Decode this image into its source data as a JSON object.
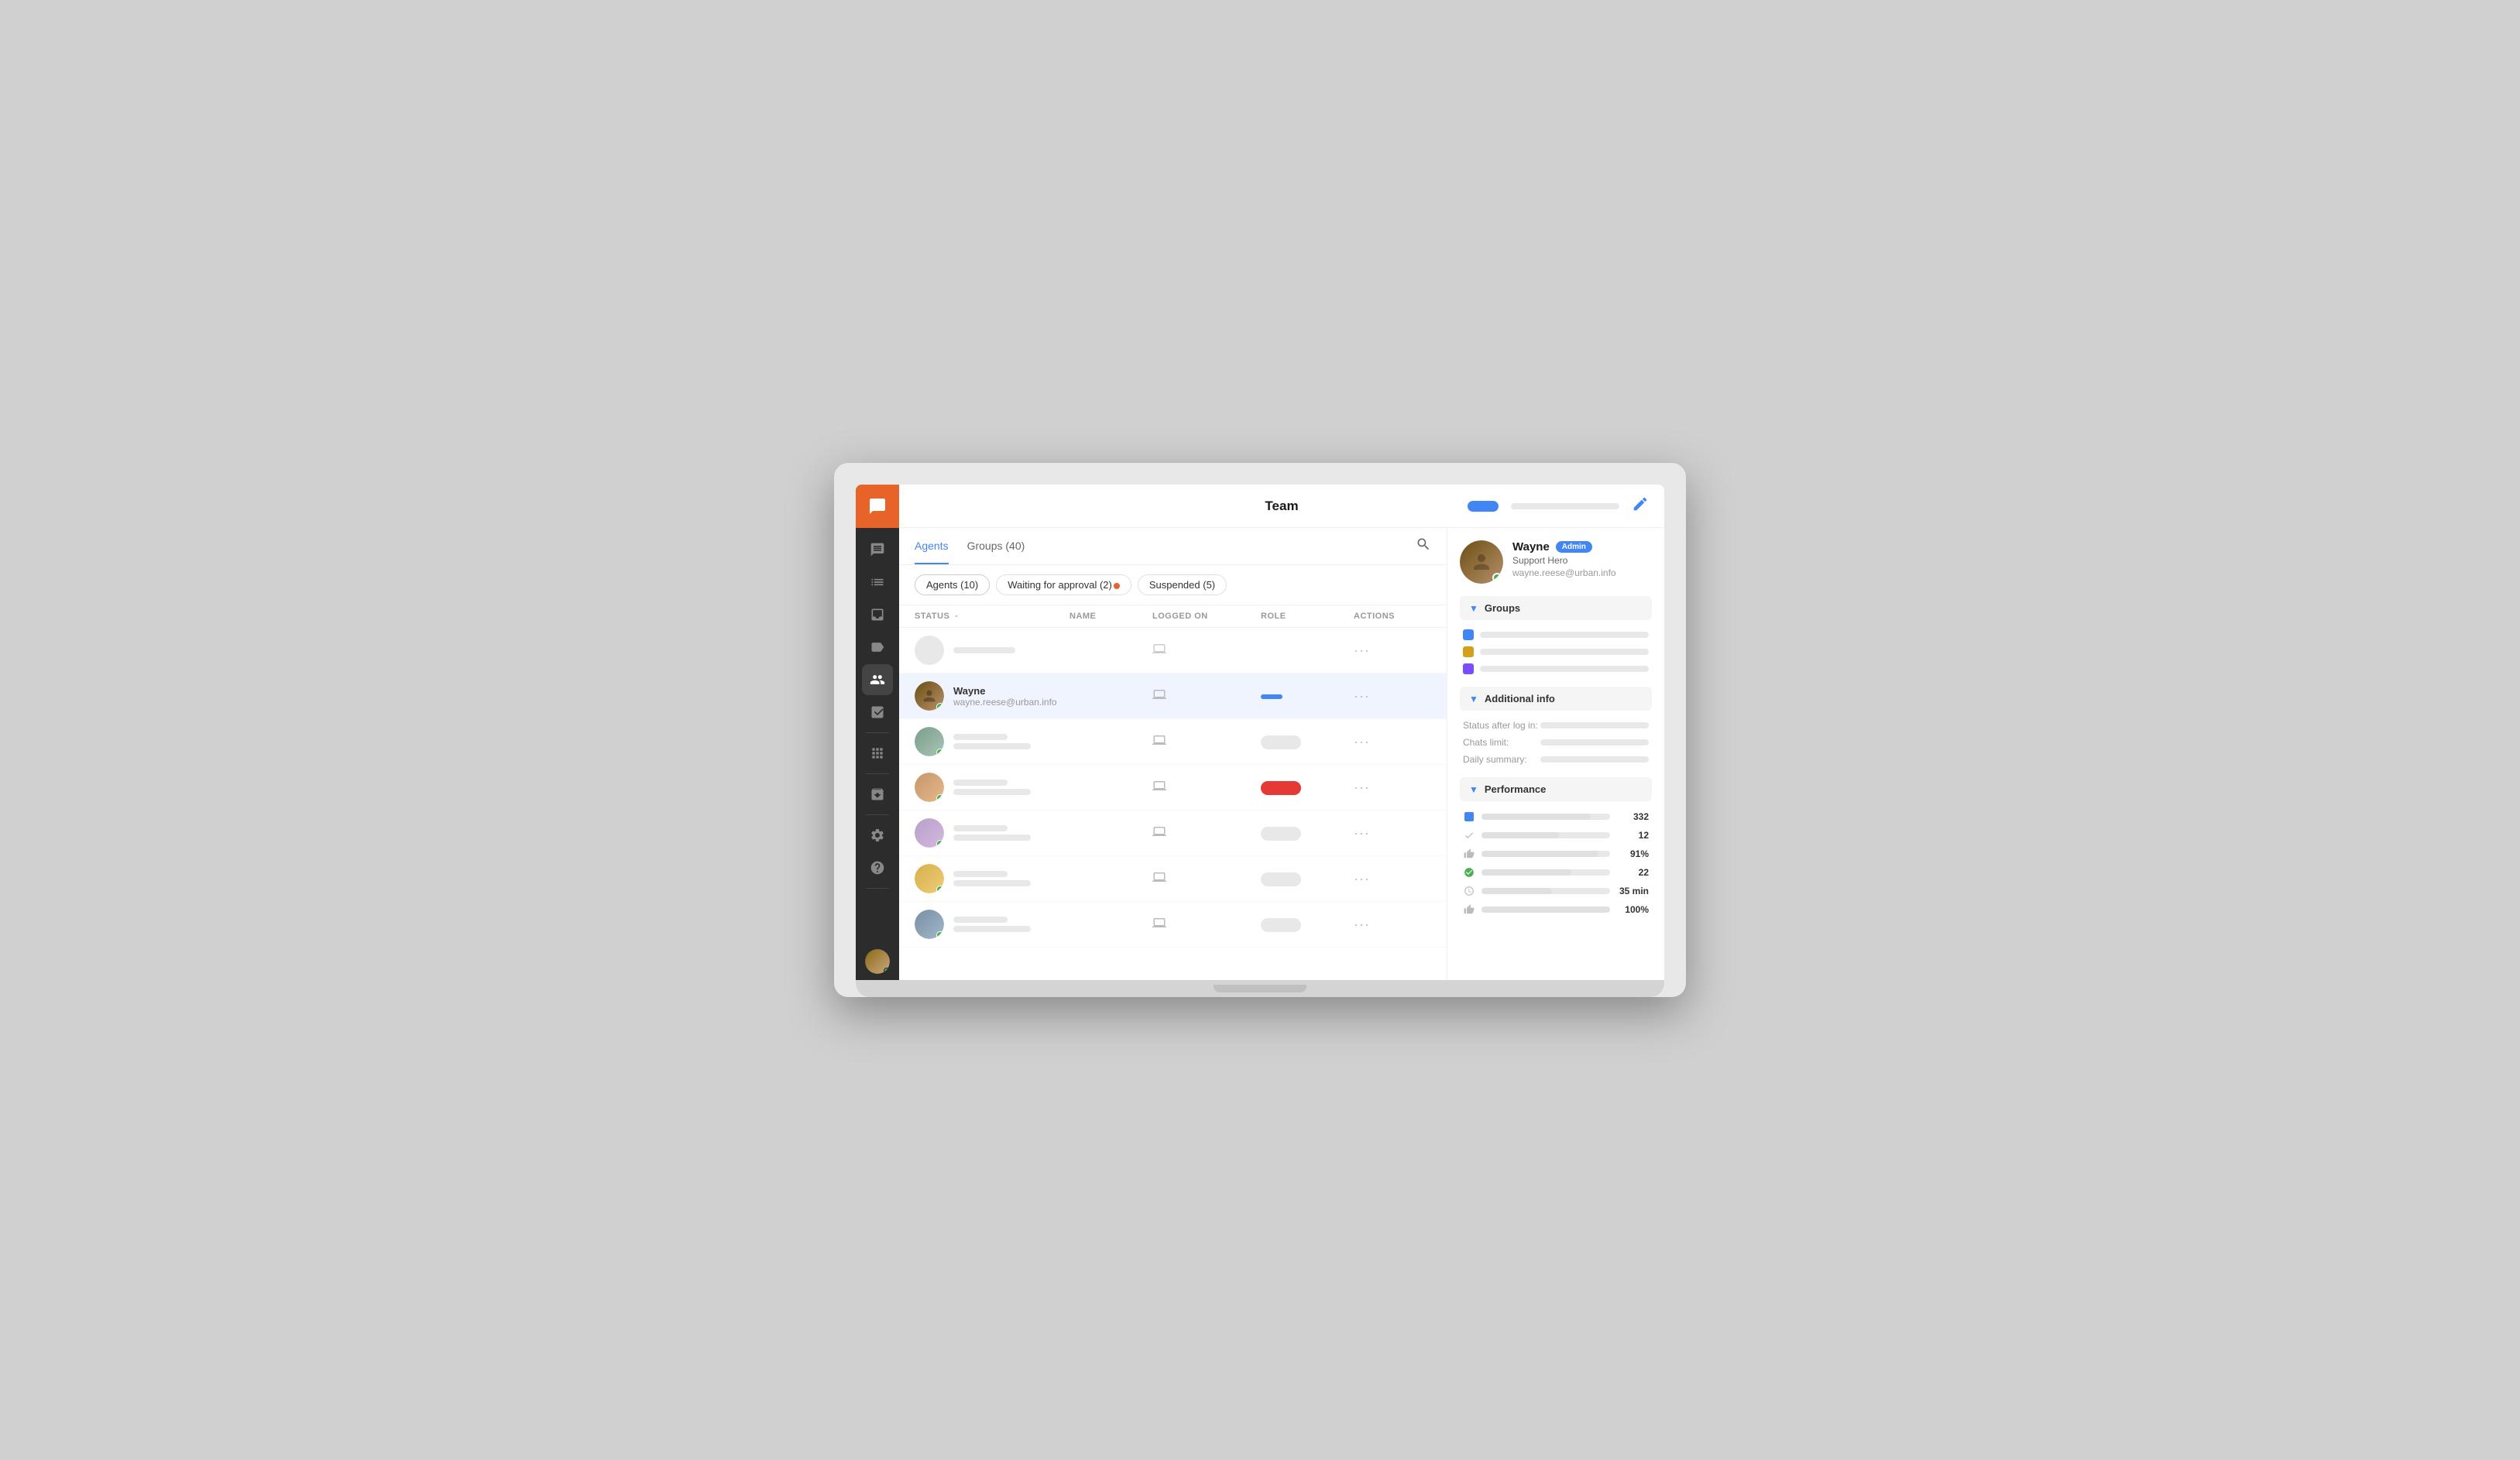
{
  "header": {
    "title": "Team",
    "button_label": "",
    "edit_icon": "✏"
  },
  "tabs": [
    {
      "label": "Agents",
      "active": true
    },
    {
      "label": "Groups (40)",
      "active": false
    }
  ],
  "filters": [
    {
      "label": "Agents (10)",
      "active": true
    },
    {
      "label": "Waiting for approval (2)",
      "active": false,
      "has_dot": true
    },
    {
      "label": "Suspended (5)",
      "active": false
    }
  ],
  "table": {
    "columns": [
      "STATUS",
      "NAME",
      "LOGGED ON",
      "ROLE",
      "ACTIONS"
    ],
    "rows": [
      {
        "id": "row-placeholder-1",
        "type": "placeholder",
        "has_avatar": false,
        "online": false
      },
      {
        "id": "row-wayne",
        "type": "real",
        "name": "Wayne",
        "email": "wayne.reese@urban.info",
        "online": true,
        "role": "admin",
        "selected": true
      },
      {
        "id": "row-2",
        "type": "placeholder-with-avatar",
        "online": true
      },
      {
        "id": "row-3",
        "type": "placeholder-with-avatar",
        "online": true,
        "role_color": "red"
      },
      {
        "id": "row-4",
        "type": "placeholder-with-avatar",
        "online": true
      },
      {
        "id": "row-5",
        "type": "placeholder-with-avatar",
        "online": true
      },
      {
        "id": "row-6",
        "type": "placeholder-with-avatar",
        "online": true
      }
    ]
  },
  "right_panel": {
    "agent": {
      "name": "Wayne",
      "admin_badge": "Admin",
      "role": "Support Hero",
      "email": "wayne.reese@urban.info",
      "online": true
    },
    "groups": {
      "label": "Groups",
      "items": [
        {
          "color": "#4285f4"
        },
        {
          "color": "#d4a017"
        },
        {
          "color": "#7c4dff"
        }
      ]
    },
    "additional_info": {
      "label": "Additional info",
      "items": [
        {
          "label": "Status after log in:"
        },
        {
          "label": "Chats limit:"
        },
        {
          "label": "Daily summary:"
        }
      ]
    },
    "performance": {
      "label": "Performance",
      "items": [
        {
          "icon": "square",
          "color": "#4285f4",
          "value": "332"
        },
        {
          "icon": "check",
          "color": "#999",
          "value": "12"
        },
        {
          "icon": "thumb-up",
          "color": "#999",
          "value": "91%"
        },
        {
          "icon": "check-circle",
          "color": "#4CAF50",
          "value": "22"
        },
        {
          "icon": "clock",
          "color": "#999",
          "value": "35 min"
        },
        {
          "icon": "thumb-up-2",
          "color": "#999",
          "value": "100%"
        }
      ]
    }
  },
  "sidebar": {
    "items": [
      {
        "icon": "chat",
        "label": "Chat",
        "active": false
      },
      {
        "icon": "list",
        "label": "List",
        "active": false
      },
      {
        "icon": "inbox",
        "label": "Inbox",
        "active": false
      },
      {
        "icon": "tag",
        "label": "Tags",
        "active": false
      },
      {
        "icon": "people",
        "label": "Team",
        "active": true
      },
      {
        "icon": "chart",
        "label": "Reports",
        "active": false
      }
    ]
  }
}
